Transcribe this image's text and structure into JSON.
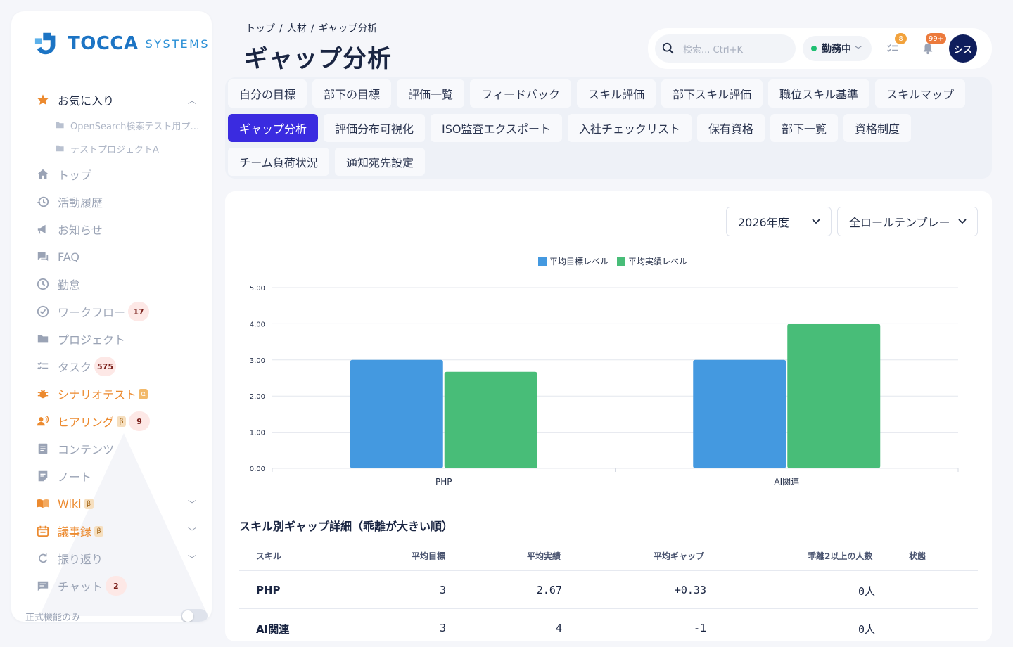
{
  "brand": {
    "name": "TOCCA",
    "sub": "SYSTEMS"
  },
  "sidebar": {
    "favorites": {
      "label": "お気に入り",
      "items": [
        "OpenSearch検索テスト用プ…",
        "テストプロジェクトA"
      ]
    },
    "items": [
      {
        "label": "トップ",
        "icon": "home-icon"
      },
      {
        "label": "活動履歴",
        "icon": "history-icon"
      },
      {
        "label": "お知らせ",
        "icon": "megaphone-icon"
      },
      {
        "label": "FAQ",
        "icon": "chat-icon"
      },
      {
        "label": "勤怠",
        "icon": "clock-icon"
      },
      {
        "label": "ワークフロー",
        "icon": "check-circle-icon",
        "badge": "17"
      },
      {
        "label": "プロジェクト",
        "icon": "folder-icon"
      },
      {
        "label": "タスク",
        "icon": "checklist-icon",
        "badge": "575"
      },
      {
        "label": "シナリオテスト",
        "icon": "bug-icon",
        "tag": "α"
      },
      {
        "label": "ヒアリング",
        "icon": "voice-icon",
        "tag": "β",
        "badge": "9"
      },
      {
        "label": "コンテンツ",
        "icon": "document-icon"
      },
      {
        "label": "ノート",
        "icon": "note-icon"
      },
      {
        "label": "Wiki",
        "icon": "book-icon",
        "tag": "β"
      },
      {
        "label": "議事録",
        "icon": "calendar-icon",
        "tag": "β"
      },
      {
        "label": "振り返り",
        "icon": "refresh-icon"
      },
      {
        "label": "チャット",
        "icon": "message-icon",
        "badge": "2"
      }
    ],
    "footer": {
      "label": "正式機能のみ"
    }
  },
  "breadcrumb": [
    "トップ",
    "人材",
    "ギャップ分析"
  ],
  "page_title": "ギャップ分析",
  "header": {
    "search_placeholder": "検索... Ctrl+K",
    "status": "勤務中",
    "tasks_badge": "8",
    "notifications_badge": "99+",
    "avatar": "シス"
  },
  "tabs": [
    "自分の目標",
    "部下の目標",
    "評価一覧",
    "フィードバック",
    "スキル評価",
    "部下スキル評価",
    "職位スキル基準",
    "スキルマップ",
    "ギャップ分析",
    "評価分布可視化",
    "ISO監査エクスポート",
    "入社チェックリスト",
    "保有資格",
    "部下一覧",
    "資格制度",
    "チーム負荷状況",
    "通知宛先設定"
  ],
  "active_tab": "ギャップ分析",
  "filters": {
    "year": "2026年度",
    "template": "全ロールテンプレー"
  },
  "colors": {
    "target": "#4499e0",
    "actual": "#48bd78",
    "accent": "#3a2be0"
  },
  "chart_data": {
    "type": "bar",
    "categories": [
      "PHP",
      "AI関連"
    ],
    "series": [
      {
        "name": "平均目標レベル",
        "values": [
          3,
          3
        ]
      },
      {
        "name": "平均実績レベル",
        "values": [
          2.67,
          4
        ]
      }
    ],
    "ylim": [
      0,
      5
    ],
    "yticks": [
      "0.00",
      "1.00",
      "2.00",
      "3.00",
      "4.00",
      "5.00"
    ],
    "legend": "top-center",
    "grid": true
  },
  "table": {
    "title": "スキル別ギャップ詳細（乖離が大きい順）",
    "headers": [
      "スキル",
      "平均目標",
      "平均実績",
      "平均ギャップ",
      "乖離2以上の人数",
      "状態"
    ],
    "rows": [
      {
        "skill": "PHP",
        "target": "3",
        "actual": "2.67",
        "gap": "+0.33",
        "count": "0人",
        "status": ""
      },
      {
        "skill": "AI関連",
        "target": "3",
        "actual": "4",
        "gap": "-1",
        "count": "0人",
        "status": ""
      }
    ]
  }
}
